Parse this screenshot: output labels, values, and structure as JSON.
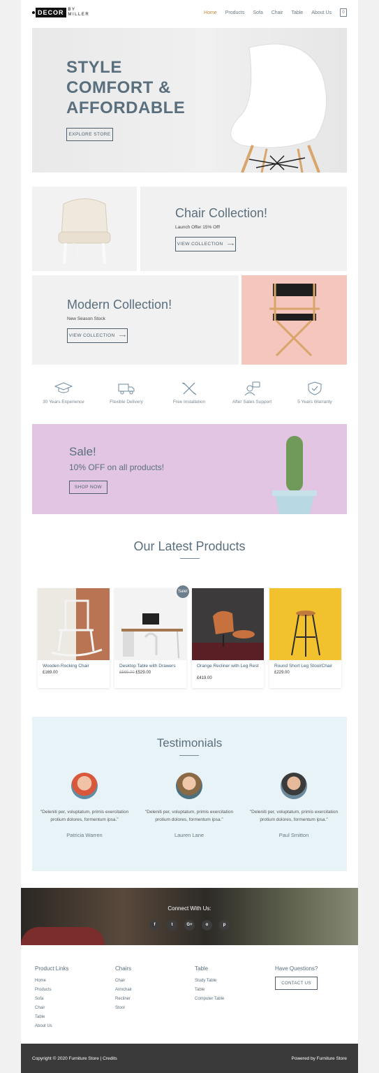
{
  "header": {
    "logo_main": "DECOR",
    "logo_by": "BY",
    "logo_sub": "MILLER",
    "nav": [
      "Home",
      "Products",
      "Sofa",
      "Chair",
      "Table",
      "About Us"
    ],
    "cart_count": "0"
  },
  "hero": {
    "title_line1": "STYLE",
    "title_line2": "COMFORT &",
    "title_line3": "AFFORDABLE",
    "button": "EXPLORE STORE"
  },
  "chair_collection": {
    "title": "Chair Collection!",
    "subtitle": "Launch Offer 15% Off!",
    "button": "VIEW COLLECTION"
  },
  "modern_collection": {
    "title": "Modern Collection!",
    "subtitle": "New Season Stock",
    "button": "VIEW COLLECTION"
  },
  "features": [
    {
      "label": "30 Years Experience",
      "icon": "graduation-cap-icon"
    },
    {
      "label": "Flexible Delivery",
      "icon": "truck-icon"
    },
    {
      "label": "Free Installation",
      "icon": "tools-icon"
    },
    {
      "label": "After Sales Support",
      "icon": "support-icon"
    },
    {
      "label": "5 Years Warranty",
      "icon": "shield-check-icon"
    }
  ],
  "sale": {
    "title": "Sale!",
    "subtitle": "10% OFF on all products!",
    "button": "SHOP NOW"
  },
  "latest": {
    "title": "Our Latest Products",
    "sale_badge": "Sale!",
    "products": [
      {
        "name": "Wooden Rocking Chair",
        "price": "£169.00",
        "old_price": ""
      },
      {
        "name": "Desktop Table with Drawers",
        "price": "£529.00",
        "old_price": "£565.00"
      },
      {
        "name": "Orange Recliner with Leg Rest",
        "price": "£419.00",
        "old_price": ""
      },
      {
        "name": "Round Short Leg Stool/Chair",
        "price": "£229.00",
        "old_price": ""
      }
    ]
  },
  "testimonials": {
    "title": "Testimonials",
    "items": [
      {
        "quote": "\"Deleniti per, voluptatum, primis exercitation protium dolores, formentum ipsa.\"",
        "name": "Patricia Warren"
      },
      {
        "quote": "\"Deleniti per, voluptatum, primis exercitation protium dolores, formentum ipsa.\"",
        "name": "Lauren Lane"
      },
      {
        "quote": "\"Deleniti per, voluptatum, primis exercitation protium dolores, formentum ipsa.\"",
        "name": "Paul Smitton"
      }
    ]
  },
  "connect": {
    "title": "Connect With Us:",
    "icons": [
      "f",
      "t",
      "G+",
      "o",
      "p"
    ]
  },
  "footer": {
    "col1": {
      "title": "Product Links",
      "links": [
        "Home",
        "Products",
        "Sofa",
        "Chair",
        "Table",
        "About Us"
      ]
    },
    "col2": {
      "title": "Chairs",
      "links": [
        "Chair",
        "Armchair",
        "Recliner",
        "Stool"
      ]
    },
    "col3": {
      "title": "Table",
      "links": [
        "Study Table",
        "Table",
        "Computer Table"
      ]
    },
    "col4": {
      "title": "Have Questions?",
      "button": "CONTACT US"
    },
    "copyright": "Copyright © 2020 Furniture Store | Credits",
    "powered": "Powered by Furniture Store"
  },
  "colors": {
    "heading": "#5a6f7d",
    "accent": "#c48a3f",
    "sale_bg": "#e1c5e3",
    "testimonial_bg": "#e8f3f8",
    "footer_bg": "#3a3a3a"
  }
}
